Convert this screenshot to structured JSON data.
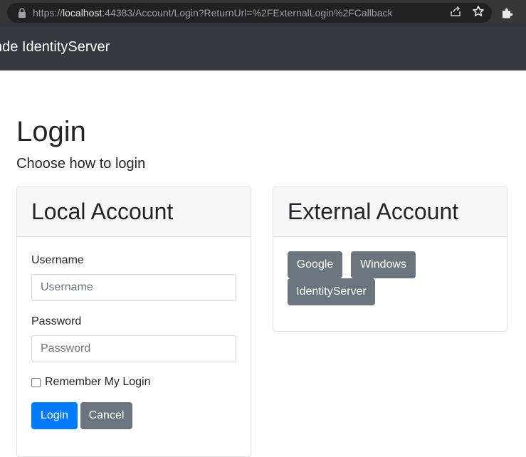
{
  "browser": {
    "url_prefix": "https://",
    "url_host": "localhost",
    "url_rest": ":44383/Account/Login?ReturnUrl=%2FExternalLogin%2FCallback",
    "icons": [
      "lock-icon",
      "share-icon",
      "star-icon",
      "extensions-icon"
    ]
  },
  "navbar": {
    "brand": "nde IdentityServer"
  },
  "page": {
    "title": "Login",
    "subtitle": "Choose how to login"
  },
  "local": {
    "header": "Local Account",
    "username_label": "Username",
    "username_placeholder": "Username",
    "password_label": "Password",
    "password_placeholder": "Password",
    "remember_label": "Remember My Login",
    "login_button": "Login",
    "cancel_button": "Cancel"
  },
  "external": {
    "header": "External Account",
    "providers": [
      "Google",
      "Windows",
      "IdentityServer"
    ]
  },
  "colors": {
    "navbar": "#343a40",
    "primary": "#007bff",
    "secondary": "#6c757d"
  }
}
